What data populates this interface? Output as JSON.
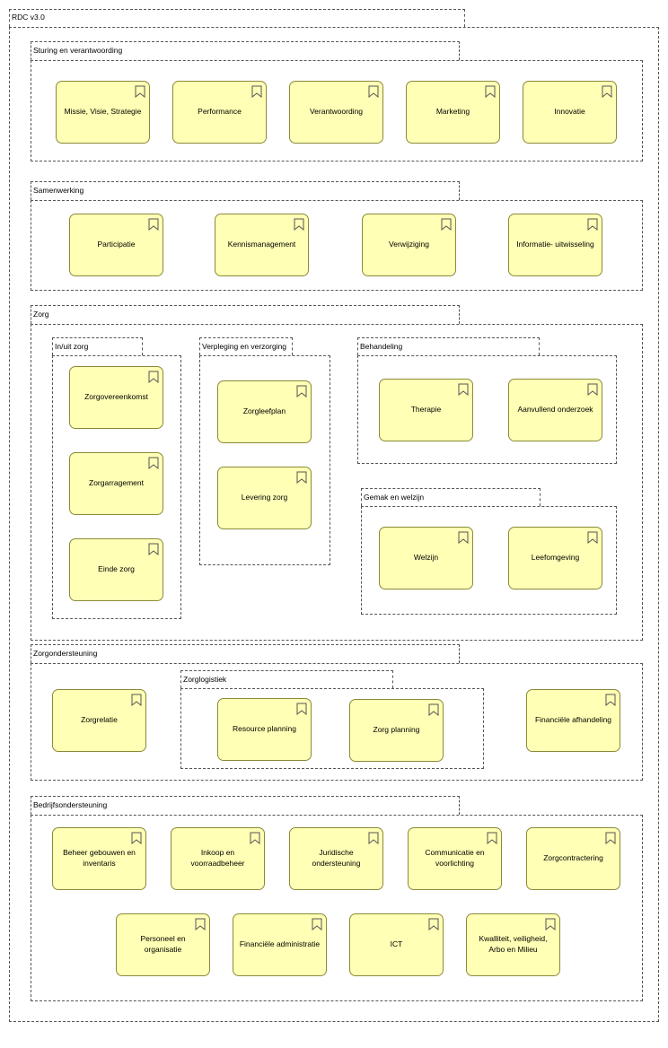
{
  "root": {
    "label": "RDC v3.0"
  },
  "groups": {
    "sturing": {
      "label": "Sturing en verantwoording"
    },
    "samenwerking": {
      "label": "Samenwerking"
    },
    "zorg": {
      "label": "Zorg"
    },
    "inuit": {
      "label": "In/uit zorg"
    },
    "verpleging": {
      "label": "Verpleging en verzorging"
    },
    "behandeling": {
      "label": "Behandeling"
    },
    "gemak": {
      "label": "Gemak en welzijn"
    },
    "zorgondersteuning": {
      "label": "Zorgondersteuning"
    },
    "zorglogistiek": {
      "label": "Zorglogistiek"
    },
    "bedrijfs": {
      "label": "Bedrijfsondersteuning"
    }
  },
  "capabilities": {
    "missie": "Missie, Visie, Strategie",
    "performance": "Performance",
    "verantwoording": "Verantwoording",
    "marketing": "Marketing",
    "innovatie": "Innovatie",
    "participatie": "Participatie",
    "kennis": "Kennismanagement",
    "verwijzing": "Verwijziging",
    "informatie": "Informatie- uitwisseling",
    "zorgovereenkomst": "Zorgovereenkomst",
    "zorgarrangement": "Zorgarragement",
    "einde": "Einde zorg",
    "zorgleefplan": "Zorgleefplan",
    "levering": "Levering zorg",
    "therapie": "Therapie",
    "aanvullend": "Aanvullend onderzoek",
    "welzijn": "Welzijn",
    "leefomgeving": "Leefomgeving",
    "zorgrelatie": "Zorgrelatie",
    "resource": "Resource planning",
    "zorgplanning": "Zorg planning",
    "financiele_afh": "Financiële afhandeling",
    "beheer": "Beheer gebouwen en\ninventaris",
    "inkoop": "Inkoop en\nvoorraadbeheer",
    "juridisch": "Juridische ondersteuning",
    "communicatie": "Communicatie en\nvoorlichting",
    "zorgcontract": "Zorgcontractering",
    "personeel": "Personeel en organisatie",
    "fin_admin": "Financiële administratie",
    "ict": "ICT",
    "kwaliteit": "Kwalliteit, veiligheid,\nArbo en Milieu"
  }
}
